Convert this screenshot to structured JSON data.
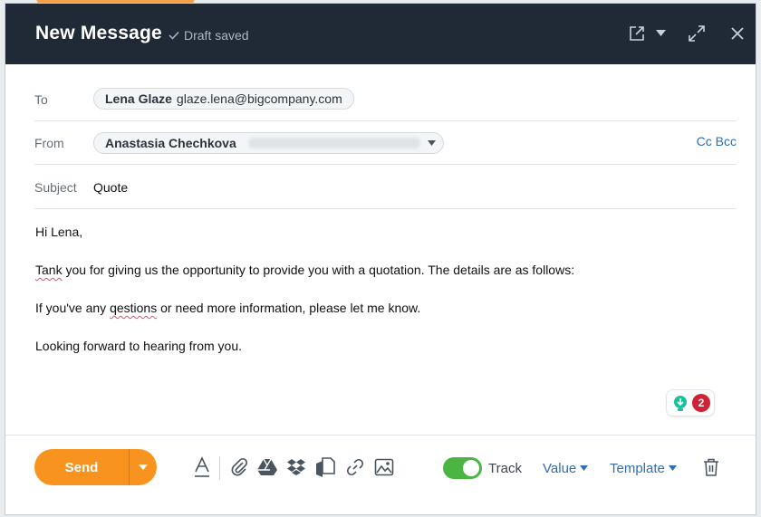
{
  "header": {
    "title": "New Message",
    "status": "Draft saved"
  },
  "recipients": {
    "to_label": "To",
    "to_name": "Lena Glaze",
    "to_email": "glaze.lena@bigcompany.com",
    "from_label": "From",
    "from_name": "Anastasia Chechkova",
    "cc_bcc": "Cc Bcc",
    "subject_label": "Subject",
    "subject_value": "Quote"
  },
  "message": {
    "greeting": "Hi Lena,",
    "line1_typo": "Tank",
    "line1_rest": " you for giving us the opportunity to provide you with a quotation. The details are as follows:",
    "line2_start": "If you've any ",
    "line2_typo": "qestions",
    "line2_rest": " or need more information, please let me know.",
    "line3": "Looking forward to hearing from you."
  },
  "grammar": {
    "issue_count": "2"
  },
  "toolbar": {
    "send_label": "Send",
    "track_label": "Track",
    "track_enabled": true,
    "value_label": "Value",
    "template_label": "Template"
  },
  "icons": [
    "check-icon",
    "popout-icon",
    "chevron-down-icon",
    "expand-icon",
    "close-icon",
    "format-text-icon",
    "paperclip-icon",
    "google-drive-icon",
    "dropbox-icon",
    "document-icon",
    "link-icon",
    "image-icon",
    "trash-icon",
    "lightbulb-icon"
  ],
  "colors": {
    "header_bg": "#1f2a36",
    "accent_orange": "#f7931e",
    "link_blue": "#2f6db5",
    "toggle_green": "#4bb543",
    "badge_red": "#cf2338",
    "grammar_teal": "#15c39a"
  }
}
